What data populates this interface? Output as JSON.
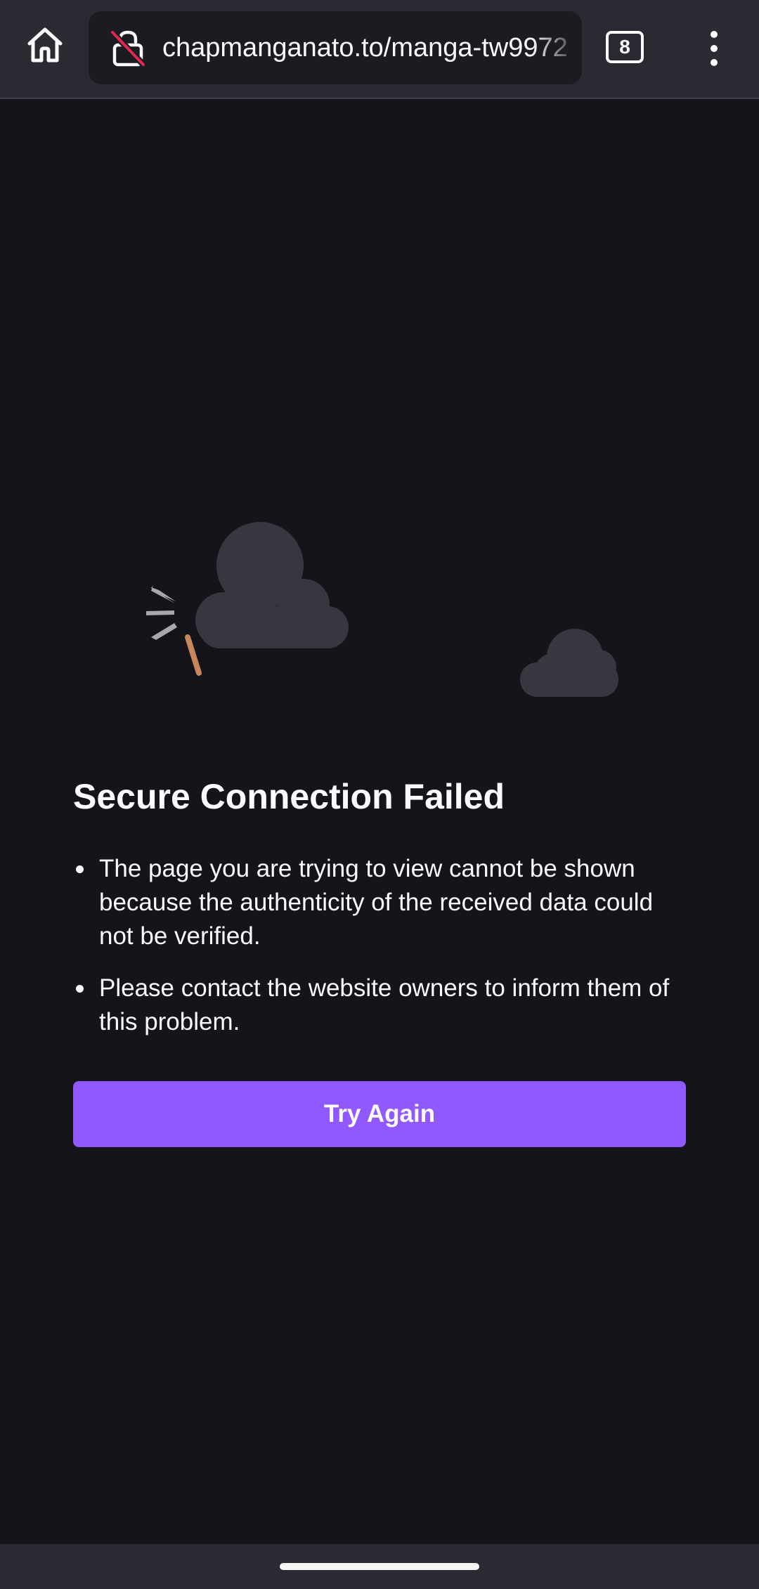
{
  "toolbar": {
    "url": "chapmanganato.to/manga-tw9972",
    "tab_count": "8",
    "home_icon": "home-icon",
    "lock_icon": "broken-lock-icon",
    "menu_icon": "vertical-ellipsis-icon"
  },
  "error": {
    "title": "Secure Connection Failed",
    "items": [
      "The page you are trying to view cannot be shown because the authenticity of the received data could not be verified.",
      "Please contact the website owners to inform them of this problem."
    ],
    "button_label": "Try Again"
  },
  "colors": {
    "toolbar_bg": "#2b2a33",
    "urlbar_bg": "#1c1b22",
    "page_bg": "#15141a",
    "accent": "#9059ff",
    "cloud": "#38373f",
    "text": "#fbfbfe",
    "stick": "#c8865d",
    "lock_slash": "#e22850"
  }
}
